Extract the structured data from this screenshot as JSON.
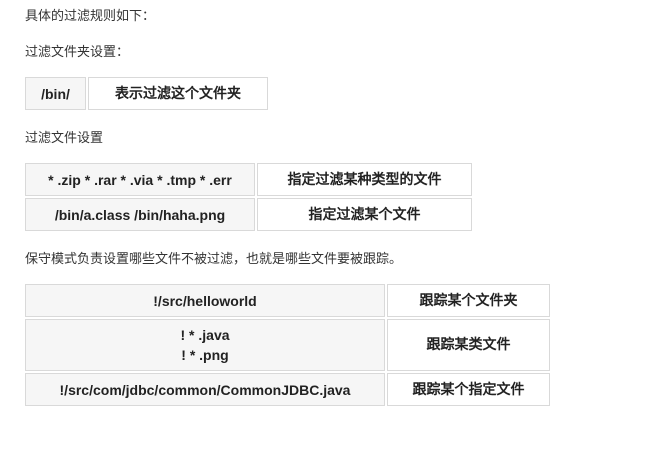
{
  "intro": "具体的过滤规则如下：",
  "folder_section": {
    "heading": "过滤文件夹设置：",
    "rows": [
      {
        "pattern": "/bin/",
        "description": "表示过滤这个文件夹"
      }
    ]
  },
  "file_section": {
    "heading": "过滤文件设置",
    "rows": [
      {
        "pattern": "* .zip * .rar * .via * .tmp * .err",
        "description": "指定过滤某种类型的文件"
      },
      {
        "pattern": "/bin/a.class /bin/haha.png",
        "description": "指定过滤某个文件"
      }
    ]
  },
  "keep_section": {
    "heading": "保守模式负责设置哪些文件不被过滤，也就是哪些文件要被跟踪。",
    "rows": [
      {
        "pattern_lines": [
          "!/src/helloworld"
        ],
        "description": "跟踪某个文件夹"
      },
      {
        "pattern_lines": [
          "! * .java",
          "! * .png"
        ],
        "description": "跟踪某类文件"
      },
      {
        "pattern_lines": [
          "!/src/com/jdbc/common/CommonJDBC.java"
        ],
        "description": "跟踪某个指定文件"
      }
    ]
  }
}
